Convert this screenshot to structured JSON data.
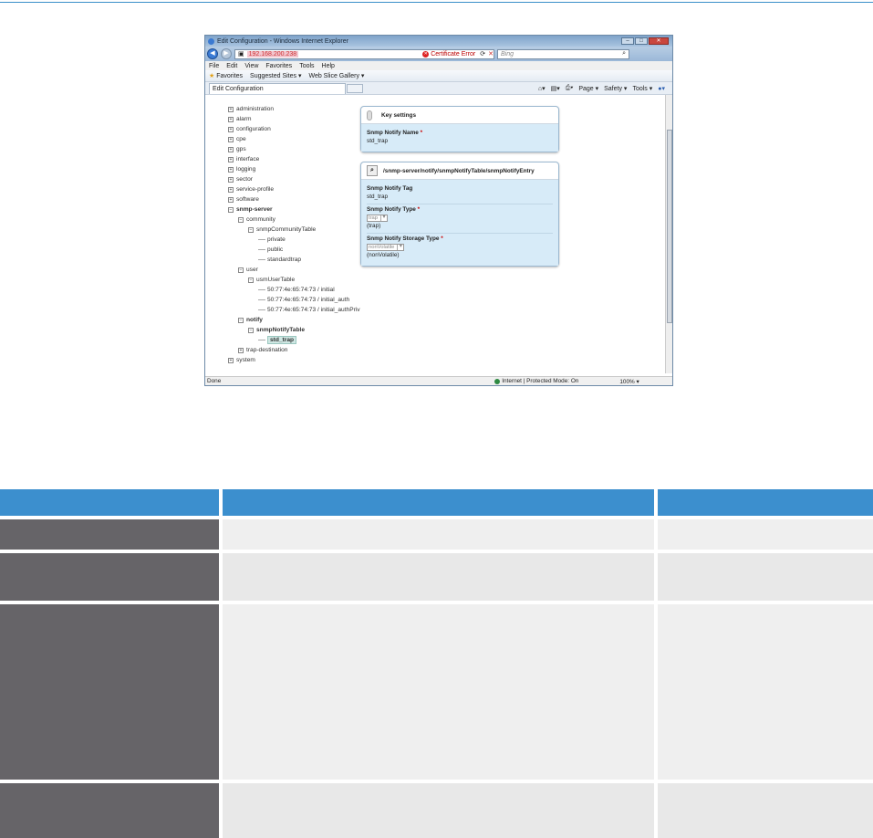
{
  "window": {
    "title": "Edit Configuration - Windows Internet Explorer",
    "address": "192.168.200.238",
    "cert_error": "Certificate Error",
    "search_placeholder": "Bing",
    "controls": [
      "minimize",
      "maximize",
      "close"
    ]
  },
  "menu": [
    "File",
    "Edit",
    "View",
    "Favorites",
    "Tools",
    "Help"
  ],
  "favorites": {
    "label": "Favorites",
    "items": [
      "Suggested Sites ▾",
      "Web Slice Gallery ▾"
    ]
  },
  "tab": {
    "label": "Edit Configuration",
    "commands": [
      "Page ▾",
      "Safety ▾",
      "Tools ▾"
    ]
  },
  "tree": [
    {
      "label": "administration",
      "toggle": "+",
      "level": 0
    },
    {
      "label": "alarm",
      "toggle": "+",
      "level": 0
    },
    {
      "label": "configuration",
      "toggle": "+",
      "level": 0
    },
    {
      "label": "cpe",
      "toggle": "+",
      "level": 0
    },
    {
      "label": "gps",
      "toggle": "+",
      "level": 0
    },
    {
      "label": "interface",
      "toggle": "+",
      "level": 0
    },
    {
      "label": "logging",
      "toggle": "+",
      "level": 0
    },
    {
      "label": "sector",
      "toggle": "+",
      "level": 0
    },
    {
      "label": "service-profile",
      "toggle": "+",
      "level": 0
    },
    {
      "label": "software",
      "toggle": "+",
      "level": 0
    },
    {
      "label": "snmp-server",
      "toggle": "−",
      "level": 0,
      "bold": true
    },
    {
      "label": "community",
      "toggle": "−",
      "level": 1
    },
    {
      "label": "snmpCommunityTable",
      "toggle": "−",
      "level": 2
    },
    {
      "label": "private",
      "toggle": "",
      "level": 3
    },
    {
      "label": "public",
      "toggle": "",
      "level": 3
    },
    {
      "label": "standardtrap",
      "toggle": "",
      "level": 3
    },
    {
      "label": "user",
      "toggle": "−",
      "level": 1
    },
    {
      "label": "usmUserTable",
      "toggle": "−",
      "level": 2
    },
    {
      "label": "50:77:4e:65:74:73 / initial",
      "toggle": "",
      "level": 3
    },
    {
      "label": "50:77:4e:65:74:73 / initial_auth",
      "toggle": "",
      "level": 3
    },
    {
      "label": "50:77:4e:65:74:73 / initial_authPriv",
      "toggle": "",
      "level": 3
    },
    {
      "label": "notify",
      "toggle": "−",
      "level": 1,
      "bold": true
    },
    {
      "label": "snmpNotifyTable",
      "toggle": "−",
      "level": 2,
      "bold": true
    },
    {
      "label": "std_trap",
      "toggle": "",
      "level": 3,
      "selected": true
    },
    {
      "label": "trap-destination",
      "toggle": "+",
      "level": 1
    },
    {
      "label": "system",
      "toggle": "+",
      "level": 0
    }
  ],
  "key_panel": {
    "title": "Key settings",
    "field_label": "Snmp Notify Name",
    "field_value": "std_trap"
  },
  "entry_panel": {
    "title": "/snmp-server/notify/snmpNotifyTable/snmpNotifyEntry",
    "tag_label": "Snmp Notify Tag",
    "tag_value": "std_trap",
    "type_label": "Snmp Notify Type",
    "type_select": "trap",
    "type_value": "(trap)",
    "storage_label": "Snmp Notify Storage Type",
    "storage_select": "nonVolatile",
    "storage_value": "(nonVolatile)"
  },
  "status": {
    "left": "Done",
    "zone": "Internet | Protected Mode: On",
    "zoom": "100%"
  },
  "colors": {
    "header_blue": "#3c8fce",
    "label_col": "#666468",
    "cell_bg": "#efefef"
  }
}
